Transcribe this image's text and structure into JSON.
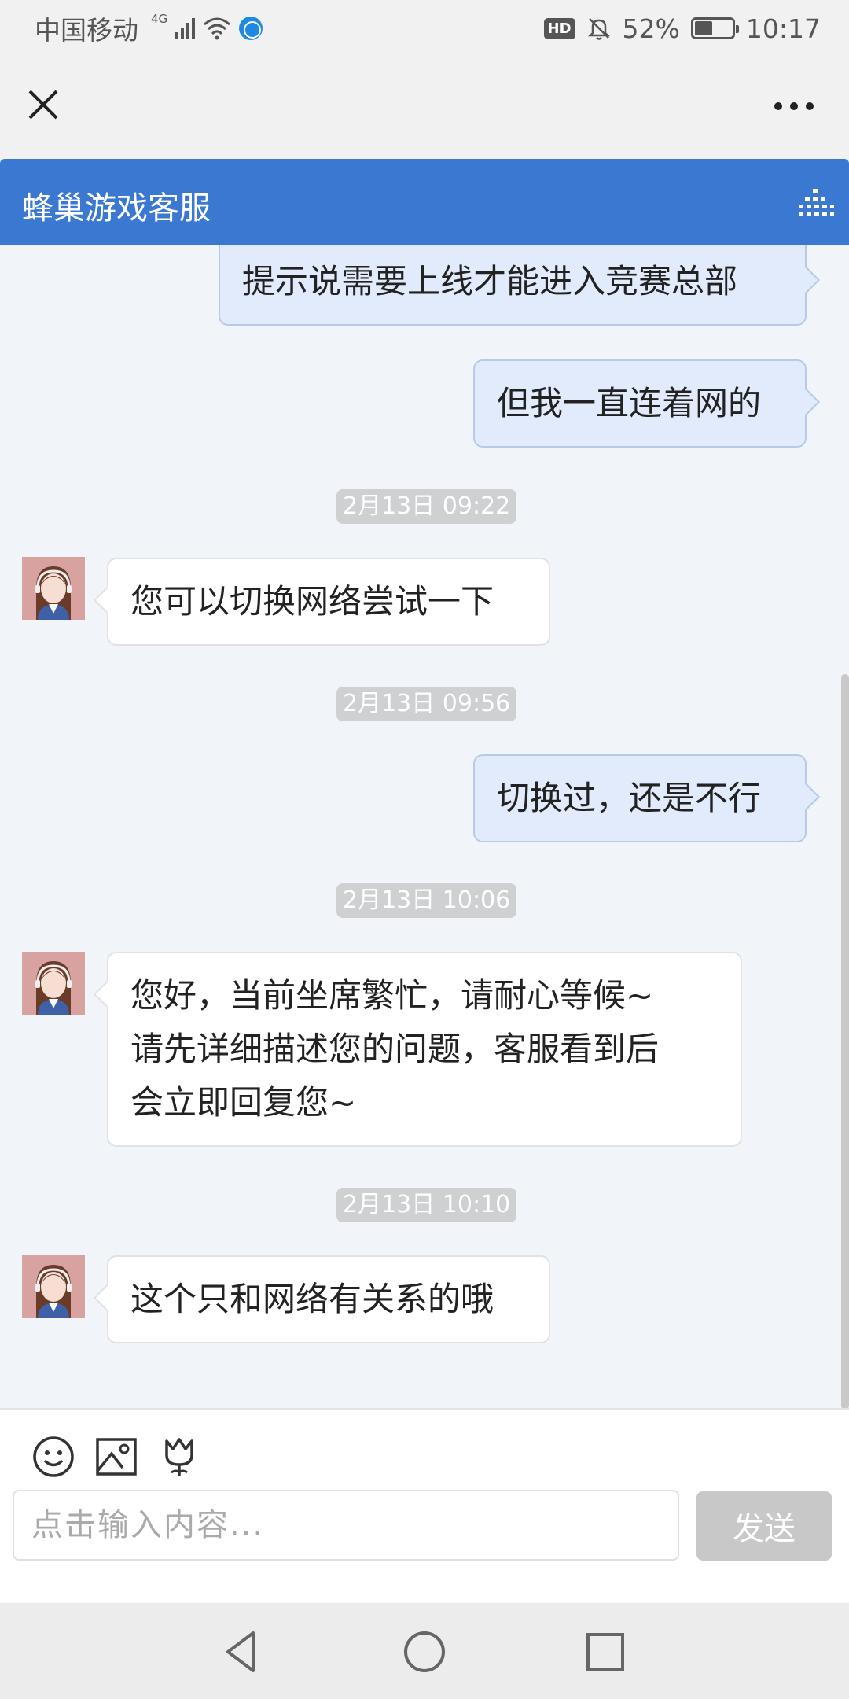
{
  "status_bar": {
    "carrier": "中国移动",
    "network": "4G",
    "hd_label": "HD",
    "battery_percent": "52%",
    "battery_level": 0.52,
    "time": "10:17"
  },
  "header": {
    "title": "蜂巢游戏客服"
  },
  "messages": [
    {
      "kind": "outgoing",
      "text": "提示说需要上线才能进入竞赛总部"
    },
    {
      "kind": "outgoing",
      "text": "但我一直连着网的"
    },
    {
      "kind": "timestamp",
      "text": "2月13日 09:22"
    },
    {
      "kind": "incoming",
      "text": "您可以切换网络尝试一下"
    },
    {
      "kind": "timestamp",
      "text": "2月13日 09:56"
    },
    {
      "kind": "outgoing",
      "text": "切换过，还是不行"
    },
    {
      "kind": "timestamp",
      "text": "2月13日 10:06"
    },
    {
      "kind": "incoming",
      "lines": [
        "您好，当前坐席繁忙，请耐心等候~",
        "请先详细描述您的问题，客服看到后",
        "会立即回复您~"
      ]
    },
    {
      "kind": "timestamp",
      "text": "2月13日 10:10"
    },
    {
      "kind": "incoming",
      "text": "这个只和网络有关系的哦"
    }
  ],
  "input": {
    "placeholder": "点击输入内容...",
    "value": ""
  },
  "send_label": "发送",
  "icons": {
    "status": [
      "signal-icon",
      "wifi-icon",
      "globe-icon",
      "mute-icon",
      "battery-icon"
    ],
    "toolbar": [
      "emoji-icon",
      "image-icon",
      "flower-icon"
    ],
    "nav": [
      "back-icon",
      "home-icon",
      "recents-icon"
    ]
  },
  "colors": {
    "header": "#3a78d2",
    "outgoing_bubble": "#e1ebfb",
    "incoming_bubble": "#ffffff",
    "timestamp_bg": "#cfd0d2",
    "send_button": "#c8c8c8"
  }
}
